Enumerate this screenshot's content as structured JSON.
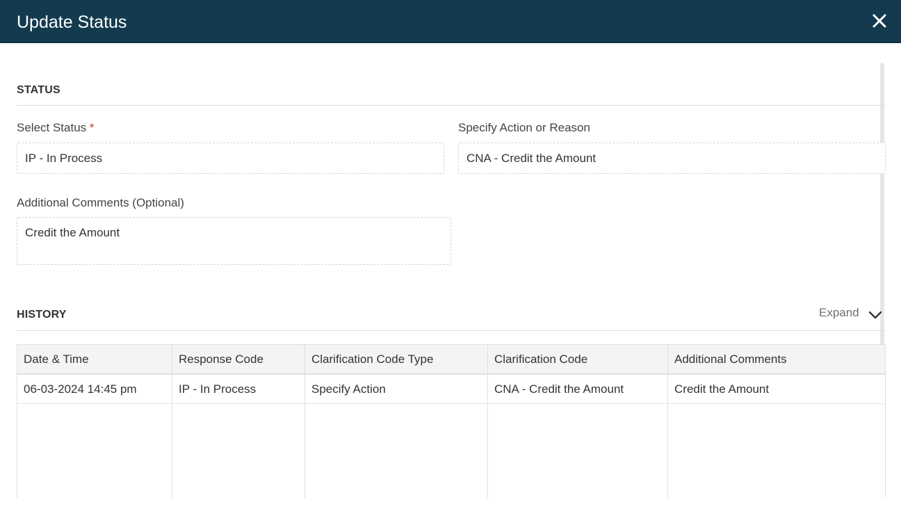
{
  "dialog": {
    "title": "Update Status",
    "header_color": "#143a4f"
  },
  "status_section": {
    "heading": "STATUS",
    "select_status": {
      "label": "Select Status",
      "required_marker": "*",
      "value": "IP - In Process"
    },
    "action_reason": {
      "label": "Specify Action or Reason",
      "value": "CNA - Credit the Amount"
    },
    "comments": {
      "label": "Additional Comments (Optional)",
      "value": "Credit the Amount"
    }
  },
  "history_section": {
    "heading": "HISTORY",
    "expand_label": "Expand",
    "expand_icon": "chevron-down-icon",
    "columns": [
      "Date & Time",
      "Response Code",
      "Clarification Code Type",
      "Clarification Code",
      "Additional Comments"
    ],
    "rows": [
      [
        "06-03-2024 14:45 pm",
        "IP - In Process",
        "Specify Action",
        "CNA - Credit the Amount",
        "Credit the Amount"
      ]
    ]
  }
}
